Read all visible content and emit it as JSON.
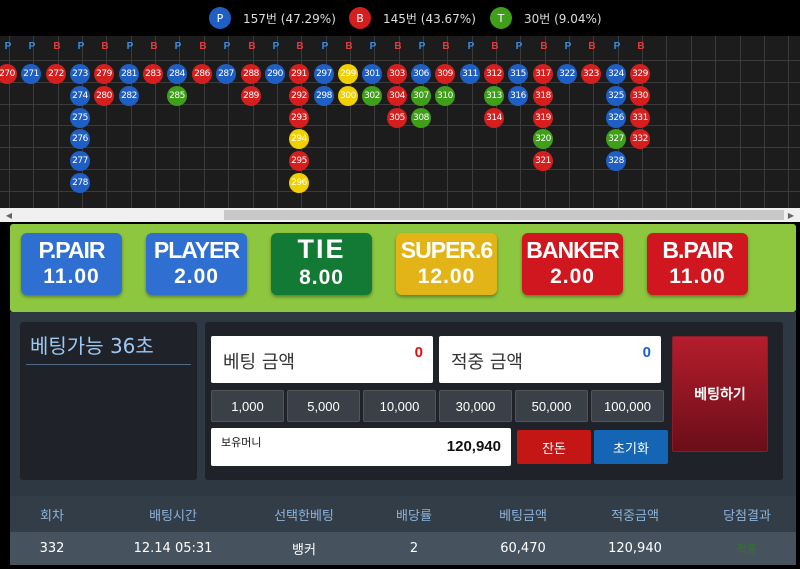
{
  "stats": [
    {
      "letter": "P",
      "text": "157번 (47.29%)",
      "color": "#1f5fc4"
    },
    {
      "letter": "B",
      "text": "145번 (43.67%)",
      "color": "#d51f1f"
    },
    {
      "letter": "T",
      "text": "30번 (9.04%)",
      "color": "#3f9f1a"
    }
  ],
  "road": {
    "headers": [
      "P",
      "P",
      "B",
      "P",
      "B",
      "P",
      "B",
      "P",
      "B",
      "P",
      "B",
      "P",
      "B",
      "P",
      "B",
      "P",
      "B",
      "P",
      "B",
      "P",
      "B",
      "P",
      "B",
      "P",
      "B",
      "P",
      "B"
    ],
    "header_colors": {
      "P": "#3a8ee6",
      "B": "#e03c3c"
    },
    "columns": [
      [
        [
          "270",
          "b"
        ]
      ],
      [
        [
          "271",
          "p"
        ]
      ],
      [
        [
          "272",
          "b"
        ]
      ],
      [
        [
          "273",
          "p"
        ],
        [
          "274",
          "p"
        ],
        [
          "275",
          "p"
        ],
        [
          "276",
          "p"
        ],
        [
          "277",
          "p"
        ],
        [
          "278",
          "p"
        ]
      ],
      [
        [
          "279",
          "b"
        ],
        [
          "280",
          "b"
        ]
      ],
      [
        [
          "281",
          "p"
        ],
        [
          "282",
          "p"
        ]
      ],
      [
        [
          "283",
          "b"
        ]
      ],
      [
        [
          "284",
          "p"
        ],
        [
          "285",
          "t"
        ]
      ],
      [
        [
          "286",
          "b"
        ]
      ],
      [
        [
          "287",
          "p"
        ]
      ],
      [
        [
          "288",
          "b"
        ],
        [
          "289",
          "b"
        ]
      ],
      [
        [
          "290",
          "p"
        ]
      ],
      [
        [
          "291",
          "b"
        ],
        [
          "292",
          "b"
        ],
        [
          "293",
          "b"
        ],
        [
          "294",
          "y"
        ],
        [
          "295",
          "b"
        ],
        [
          "296",
          "y"
        ]
      ],
      [
        [
          "297",
          "p"
        ],
        [
          "298",
          "p"
        ]
      ],
      [
        [
          "299",
          "y"
        ],
        [
          "300",
          "y"
        ]
      ],
      [
        [
          "301",
          "p"
        ],
        [
          "302",
          "t"
        ]
      ],
      [
        [
          "303",
          "b"
        ],
        [
          "304",
          "b"
        ],
        [
          "305",
          "b"
        ]
      ],
      [
        [
          "306",
          "p"
        ],
        [
          "307",
          "t"
        ],
        [
          "308",
          "t"
        ]
      ],
      [
        [
          "309",
          "b"
        ],
        [
          "310",
          "t"
        ]
      ],
      [
        [
          "311",
          "p"
        ]
      ],
      [
        [
          "312",
          "b"
        ],
        [
          "313",
          "t"
        ],
        [
          "314",
          "b"
        ]
      ],
      [
        [
          "315",
          "p"
        ],
        [
          "316",
          "p"
        ]
      ],
      [
        [
          "317",
          "b"
        ],
        [
          "318",
          "b"
        ],
        [
          "319",
          "b"
        ],
        [
          "320",
          "t"
        ],
        [
          "321",
          "b"
        ]
      ],
      [
        [
          "322",
          "p"
        ]
      ],
      [
        [
          "323",
          "b"
        ]
      ],
      [
        [
          "324",
          "p"
        ],
        [
          "325",
          "p"
        ],
        [
          "326",
          "p"
        ],
        [
          "327",
          "t"
        ],
        [
          "328",
          "p"
        ]
      ],
      [
        [
          "329",
          "b"
        ],
        [
          "330",
          "b"
        ],
        [
          "331",
          "b"
        ],
        [
          "332",
          "b"
        ]
      ]
    ]
  },
  "bets": [
    {
      "name": "P.PAIR",
      "odds": "11.00",
      "color": "#2f6fd1"
    },
    {
      "name": "PLAYER",
      "odds": "2.00",
      "color": "#2f6fd1"
    },
    {
      "name": "TIE",
      "odds": "8.00",
      "color": "#127a35"
    },
    {
      "name": "SUPER.6",
      "odds": "12.00",
      "color": "#e3b417"
    },
    {
      "name": "BANKER",
      "odds": "2.00",
      "color": "#d0171f"
    },
    {
      "name": "B.PAIR",
      "odds": "11.00",
      "color": "#d0171f"
    }
  ],
  "panel": {
    "timer": "베팅가능 36초",
    "bet_amount_label": "베팅 금액",
    "bet_amount_value": "0",
    "win_amount_label": "적중 금액",
    "win_amount_value": "0",
    "chips": [
      "1,000",
      "5,000",
      "10,000",
      "30,000",
      "50,000",
      "100,000"
    ],
    "money_label": "보유머니",
    "money_value": "120,940",
    "allin_label": "잔돈",
    "reset_label": "초기화",
    "place_bet_label": "베팅하기"
  },
  "history": {
    "headers": [
      "회차",
      "배팅시간",
      "선택한베팅",
      "배당률",
      "베팅금액",
      "적중금액",
      "당첨결과"
    ],
    "rows": [
      [
        "332",
        "12.14 05:31",
        "뱅커",
        "2",
        "60,470",
        "120,940",
        "적중"
      ]
    ]
  }
}
